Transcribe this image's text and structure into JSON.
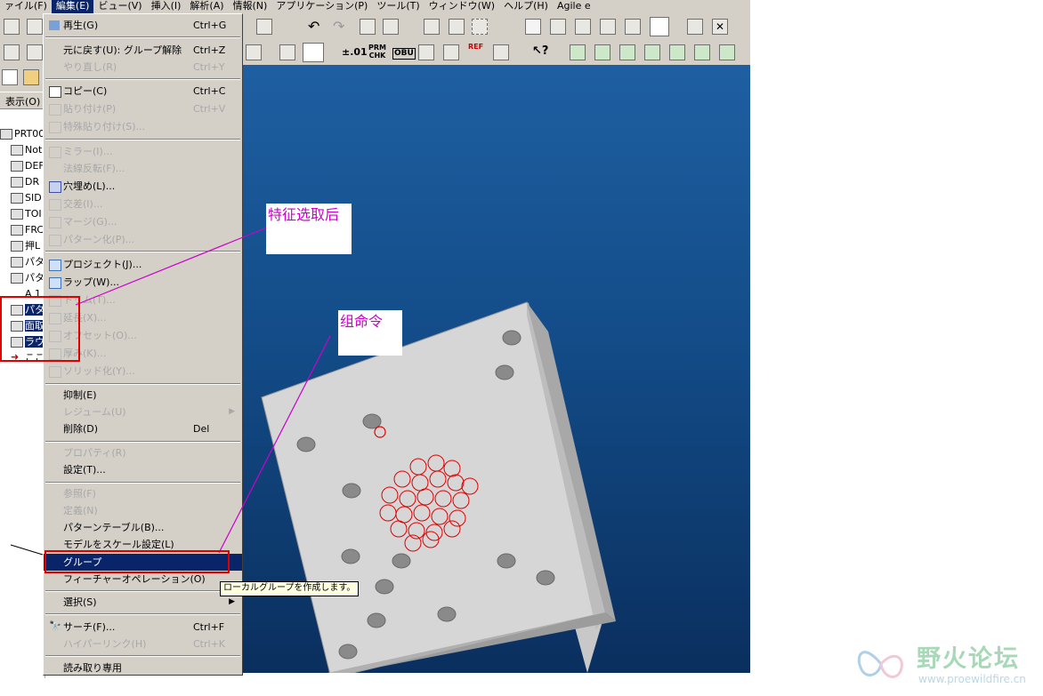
{
  "menubar": {
    "items": [
      "ァイル(F)",
      "編集(E)",
      "ビュー(V)",
      "挿入(I)",
      "解析(A)",
      "情報(N)",
      "アプリケーション(P)",
      "ツール(T)",
      "ウィンドウ(W)",
      "ヘルプ(H)",
      "Agile e"
    ]
  },
  "toolbar2": {
    "tolerance": "±.01",
    "prm_chk": "PRM CHK",
    "obu": "OBU",
    "ref": "REF"
  },
  "tabs": {
    "show_label": "表示(O)"
  },
  "tree": {
    "items": [
      "PRT000",
      "Not",
      "DEF",
      "DR",
      "SID",
      "TOI",
      "FRC",
      "押L",
      "パタ",
      "パタ",
      "A 1",
      "パタ",
      "面取",
      "ラウ",
      "ここ"
    ]
  },
  "edit_menu": {
    "items": [
      {
        "label": "再生(G)",
        "shortcut": "Ctrl+G",
        "icon": "regenerate-icon",
        "enabled": true
      },
      {
        "label": "元に戻す(U): グループ解除",
        "shortcut": "Ctrl+Z",
        "enabled": true
      },
      {
        "label": "やり直し(R)",
        "shortcut": "Ctrl+Y",
        "enabled": false
      },
      {
        "label": "コピー(C)",
        "shortcut": "Ctrl+C",
        "icon": "copy-icon",
        "enabled": true
      },
      {
        "label": "貼り付け(P)",
        "shortcut": "Ctrl+V",
        "icon": "paste-icon",
        "enabled": false
      },
      {
        "label": "特殊貼り付け(S)...",
        "icon": "paste-special-icon",
        "enabled": false
      },
      {
        "label": "ミラー(I)...",
        "icon": "mirror-icon",
        "enabled": false
      },
      {
        "label": "法線反転(F)...",
        "enabled": false
      },
      {
        "label": "穴埋め(L)...",
        "icon": "fill-icon",
        "enabled": true
      },
      {
        "label": "交差(I)...",
        "icon": "intersect-icon",
        "enabled": false
      },
      {
        "label": "マージ(G)...",
        "icon": "merge-icon",
        "enabled": false
      },
      {
        "label": "パターン化(P)...",
        "icon": "pattern-icon",
        "enabled": false
      },
      {
        "label": "プロジェクト(J)...",
        "icon": "project-icon",
        "enabled": true
      },
      {
        "label": "ラップ(W)...",
        "icon": "wrap-icon",
        "enabled": true
      },
      {
        "label": "トリム(T)...",
        "icon": "trim-icon",
        "enabled": false
      },
      {
        "label": "延長(X)...",
        "icon": "extend-icon",
        "enabled": false
      },
      {
        "label": "オフセット(O)...",
        "icon": "offset-icon",
        "enabled": false
      },
      {
        "label": "厚み(K)...",
        "icon": "thicken-icon",
        "enabled": false
      },
      {
        "label": "ソリッド化(Y)...",
        "icon": "solidify-icon",
        "enabled": false
      },
      {
        "label": "抑制(E)",
        "enabled": true
      },
      {
        "label": "レジューム(U)",
        "enabled": false,
        "submenu": true
      },
      {
        "label": "削除(D)",
        "shortcut": "Del",
        "enabled": true
      },
      {
        "label": "プロパティ(R)",
        "enabled": false
      },
      {
        "label": "設定(T)...",
        "enabled": true
      },
      {
        "label": "参照(F)",
        "enabled": false
      },
      {
        "label": "定義(N)",
        "enabled": false
      },
      {
        "label": "パターンテーブル(B)...",
        "enabled": true
      },
      {
        "label": "モデルをスケール設定(L)",
        "enabled": true
      },
      {
        "label": "グループ",
        "enabled": true,
        "highlighted": true
      },
      {
        "label": "フィーチャーオペレーション(O)",
        "enabled": true
      },
      {
        "label": "選択(S)",
        "enabled": true,
        "submenu": true
      },
      {
        "label": "サーチ(F)...",
        "shortcut": "Ctrl+F",
        "icon": "search-icon",
        "enabled": true
      },
      {
        "label": "ハイパーリンク(H)",
        "shortcut": "Ctrl+K",
        "enabled": false
      },
      {
        "label": "読み取り専用",
        "enabled": true
      }
    ]
  },
  "tooltip": "ローカルグループを作成します。",
  "annotations": {
    "note1": "特征选取后",
    "note2": "组命令",
    "color": "#cc00cc",
    "box_color": "#e00000"
  },
  "watermark": {
    "title": "野火论坛",
    "url": "www.proewildfire.cn"
  },
  "colors": {
    "menu_bg": "#d4d0c8",
    "highlight": "#0a246a",
    "viewport_top": "#1e5fa2",
    "viewport_bottom": "#0a2f5e"
  }
}
